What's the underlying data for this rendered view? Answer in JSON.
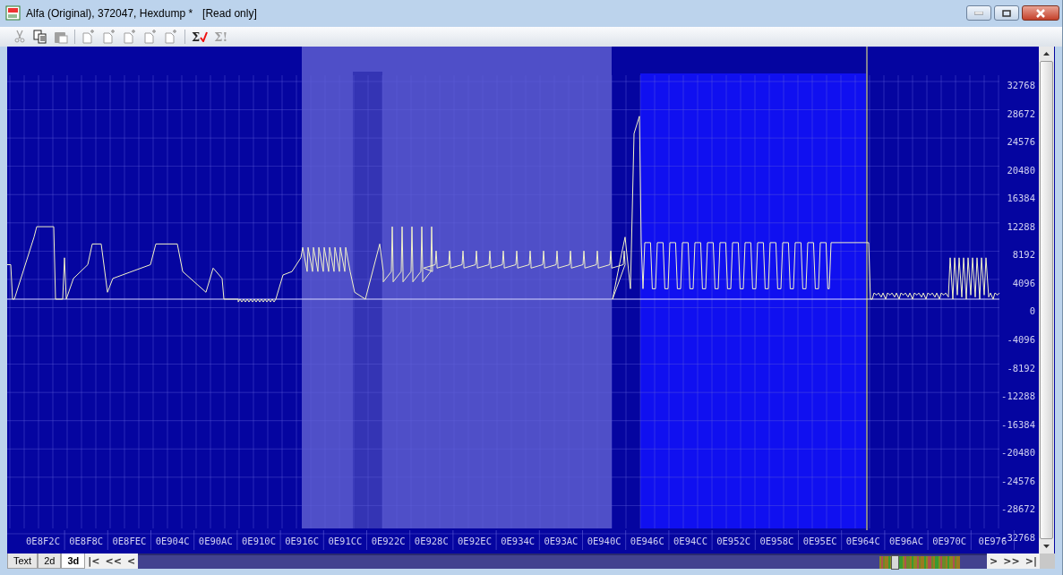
{
  "window": {
    "title": "Alfa (Original), 372047, Hexdump *",
    "mode": "[Read only]"
  },
  "toolbar": [
    {
      "kind": "cut",
      "disabled": true
    },
    {
      "kind": "copy",
      "disabled": false
    },
    {
      "kind": "paste",
      "disabled": true
    },
    {
      "kind": "doc",
      "disabled": true
    },
    {
      "kind": "doc",
      "disabled": true
    },
    {
      "kind": "doc",
      "disabled": true
    },
    {
      "kind": "doc",
      "disabled": true
    },
    {
      "kind": "doc",
      "disabled": true
    },
    {
      "kind": "sigma-check",
      "label": "Σ",
      "disabled": false
    },
    {
      "kind": "sigma",
      "label": "Σ!",
      "disabled": true
    }
  ],
  "chart": {
    "y_labels": [
      "32768",
      "28672",
      "24576",
      "20480",
      "16384",
      "12288",
      "8192",
      "4096",
      "0",
      "-4096",
      "-8192",
      "-12288",
      "-16384",
      "-20480",
      "-24576",
      "-28672",
      "-32768"
    ],
    "x_labels": [
      "0E8F2C",
      "0E8F8C",
      "0E8FEC",
      "0E904C",
      "0E90AC",
      "0E910C",
      "0E916C",
      "0E91CC",
      "0E922C",
      "0E928C",
      "0E92EC",
      "0E934C",
      "0E93AC",
      "0E940C",
      "0E946C",
      "0E94CC",
      "0E952C",
      "0E958C",
      "0E95EC",
      "0E964C",
      "0E96AC",
      "0E970C",
      "0E976"
    ]
  },
  "tabs": [
    {
      "label": "Text",
      "selected": false
    },
    {
      "label": "2d",
      "selected": false
    },
    {
      "label": "3d",
      "selected": true
    }
  ],
  "nav_left": [
    "|<",
    "<<",
    "<"
  ],
  "nav_right": [
    ">",
    ">>",
    ">|"
  ]
}
